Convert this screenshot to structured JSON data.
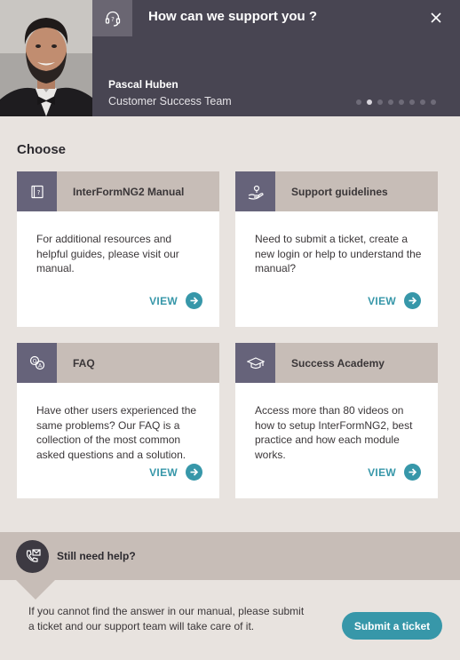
{
  "header": {
    "title": "How can we support you ?",
    "icon": "headset-support-icon",
    "close_icon": "close-icon",
    "agent_name": "Pascal Huben",
    "agent_team": "Customer Success Team",
    "slides_total": 8,
    "slide_active": 2
  },
  "choose": {
    "title": "Choose",
    "cards": [
      {
        "title": "InterFormNG2 Manual",
        "icon": "manual-book-icon",
        "text": "For additional resources and helpful guides, please visit our manual.",
        "link": "VIEW"
      },
      {
        "title": "Support guidelines",
        "icon": "hand-support-icon",
        "text": "Need to submit a ticket, create a new login or help to understand the manual?",
        "link": "VIEW"
      },
      {
        "title": "FAQ",
        "icon": "faq-chat-icon",
        "text": "Have other users experienced the same problems? Our FAQ is a collection of the most common asked questions and a solution.",
        "link": "VIEW"
      },
      {
        "title": "Success Academy",
        "icon": "graduation-cap-icon",
        "text": "Access more than 80 videos on how to setup InterFormNG2, best practice and how each module works.",
        "link": "VIEW"
      }
    ]
  },
  "help": {
    "title": "Still need help?",
    "icon": "phone-mail-icon",
    "text": "If you cannot find the answer in our manual, please submit a ticket and our support team will take care of it.",
    "button": "Submit a ticket"
  },
  "colors": {
    "header_bg": "#484552",
    "page_bg": "#e8e3df",
    "card_head_bg": "#c7bdb7",
    "card_icon_bg": "#66637a",
    "accent": "#3797a9"
  }
}
